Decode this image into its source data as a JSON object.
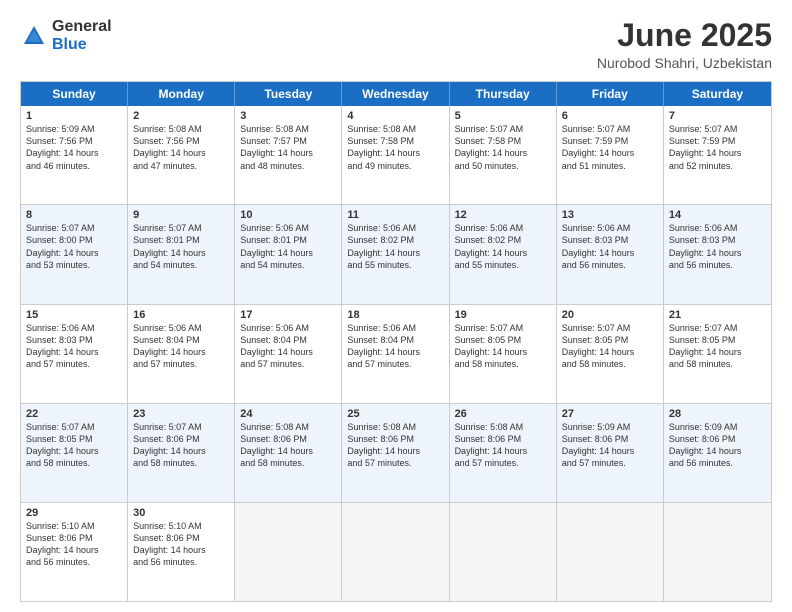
{
  "logo": {
    "general": "General",
    "blue": "Blue"
  },
  "title": "June 2025",
  "subtitle": "Nurobod Shahri, Uzbekistan",
  "days": [
    "Sunday",
    "Monday",
    "Tuesday",
    "Wednesday",
    "Thursday",
    "Friday",
    "Saturday"
  ],
  "rows": [
    {
      "alt": false,
      "cells": [
        {
          "day": "1",
          "info": "Sunrise: 5:09 AM\nSunset: 7:56 PM\nDaylight: 14 hours\nand 46 minutes."
        },
        {
          "day": "2",
          "info": "Sunrise: 5:08 AM\nSunset: 7:56 PM\nDaylight: 14 hours\nand 47 minutes."
        },
        {
          "day": "3",
          "info": "Sunrise: 5:08 AM\nSunset: 7:57 PM\nDaylight: 14 hours\nand 48 minutes."
        },
        {
          "day": "4",
          "info": "Sunrise: 5:08 AM\nSunset: 7:58 PM\nDaylight: 14 hours\nand 49 minutes."
        },
        {
          "day": "5",
          "info": "Sunrise: 5:07 AM\nSunset: 7:58 PM\nDaylight: 14 hours\nand 50 minutes."
        },
        {
          "day": "6",
          "info": "Sunrise: 5:07 AM\nSunset: 7:59 PM\nDaylight: 14 hours\nand 51 minutes."
        },
        {
          "day": "7",
          "info": "Sunrise: 5:07 AM\nSunset: 7:59 PM\nDaylight: 14 hours\nand 52 minutes."
        }
      ]
    },
    {
      "alt": true,
      "cells": [
        {
          "day": "8",
          "info": "Sunrise: 5:07 AM\nSunset: 8:00 PM\nDaylight: 14 hours\nand 53 minutes."
        },
        {
          "day": "9",
          "info": "Sunrise: 5:07 AM\nSunset: 8:01 PM\nDaylight: 14 hours\nand 54 minutes."
        },
        {
          "day": "10",
          "info": "Sunrise: 5:06 AM\nSunset: 8:01 PM\nDaylight: 14 hours\nand 54 minutes."
        },
        {
          "day": "11",
          "info": "Sunrise: 5:06 AM\nSunset: 8:02 PM\nDaylight: 14 hours\nand 55 minutes."
        },
        {
          "day": "12",
          "info": "Sunrise: 5:06 AM\nSunset: 8:02 PM\nDaylight: 14 hours\nand 55 minutes."
        },
        {
          "day": "13",
          "info": "Sunrise: 5:06 AM\nSunset: 8:03 PM\nDaylight: 14 hours\nand 56 minutes."
        },
        {
          "day": "14",
          "info": "Sunrise: 5:06 AM\nSunset: 8:03 PM\nDaylight: 14 hours\nand 56 minutes."
        }
      ]
    },
    {
      "alt": false,
      "cells": [
        {
          "day": "15",
          "info": "Sunrise: 5:06 AM\nSunset: 8:03 PM\nDaylight: 14 hours\nand 57 minutes."
        },
        {
          "day": "16",
          "info": "Sunrise: 5:06 AM\nSunset: 8:04 PM\nDaylight: 14 hours\nand 57 minutes."
        },
        {
          "day": "17",
          "info": "Sunrise: 5:06 AM\nSunset: 8:04 PM\nDaylight: 14 hours\nand 57 minutes."
        },
        {
          "day": "18",
          "info": "Sunrise: 5:06 AM\nSunset: 8:04 PM\nDaylight: 14 hours\nand 57 minutes."
        },
        {
          "day": "19",
          "info": "Sunrise: 5:07 AM\nSunset: 8:05 PM\nDaylight: 14 hours\nand 58 minutes."
        },
        {
          "day": "20",
          "info": "Sunrise: 5:07 AM\nSunset: 8:05 PM\nDaylight: 14 hours\nand 58 minutes."
        },
        {
          "day": "21",
          "info": "Sunrise: 5:07 AM\nSunset: 8:05 PM\nDaylight: 14 hours\nand 58 minutes."
        }
      ]
    },
    {
      "alt": true,
      "cells": [
        {
          "day": "22",
          "info": "Sunrise: 5:07 AM\nSunset: 8:05 PM\nDaylight: 14 hours\nand 58 minutes."
        },
        {
          "day": "23",
          "info": "Sunrise: 5:07 AM\nSunset: 8:06 PM\nDaylight: 14 hours\nand 58 minutes."
        },
        {
          "day": "24",
          "info": "Sunrise: 5:08 AM\nSunset: 8:06 PM\nDaylight: 14 hours\nand 58 minutes."
        },
        {
          "day": "25",
          "info": "Sunrise: 5:08 AM\nSunset: 8:06 PM\nDaylight: 14 hours\nand 57 minutes."
        },
        {
          "day": "26",
          "info": "Sunrise: 5:08 AM\nSunset: 8:06 PM\nDaylight: 14 hours\nand 57 minutes."
        },
        {
          "day": "27",
          "info": "Sunrise: 5:09 AM\nSunset: 8:06 PM\nDaylight: 14 hours\nand 57 minutes."
        },
        {
          "day": "28",
          "info": "Sunrise: 5:09 AM\nSunset: 8:06 PM\nDaylight: 14 hours\nand 56 minutes."
        }
      ]
    },
    {
      "alt": false,
      "cells": [
        {
          "day": "29",
          "info": "Sunrise: 5:10 AM\nSunset: 8:06 PM\nDaylight: 14 hours\nand 56 minutes."
        },
        {
          "day": "30",
          "info": "Sunrise: 5:10 AM\nSunset: 8:06 PM\nDaylight: 14 hours\nand 56 minutes."
        },
        {
          "day": "",
          "info": ""
        },
        {
          "day": "",
          "info": ""
        },
        {
          "day": "",
          "info": ""
        },
        {
          "day": "",
          "info": ""
        },
        {
          "day": "",
          "info": ""
        }
      ]
    }
  ]
}
